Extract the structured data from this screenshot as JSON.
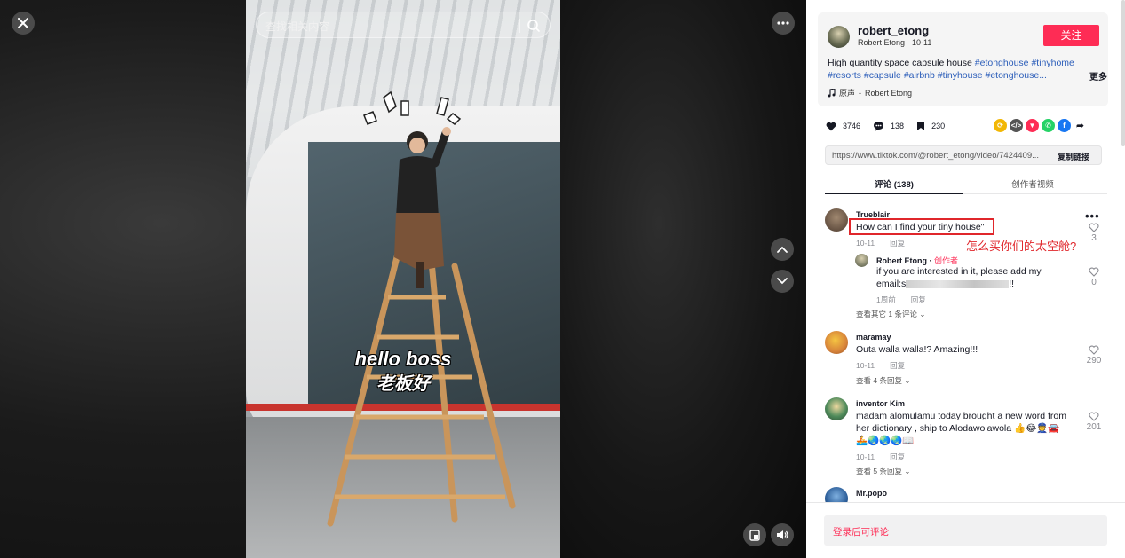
{
  "video": {
    "search_placeholder": "查找相关内容",
    "overlay_line1": "hello boss",
    "overlay_line2": "老板好"
  },
  "author": {
    "username": "robert_etong",
    "display_name": "Robert Etong",
    "date": "10-11",
    "follow_label": "关注"
  },
  "post": {
    "description_text": "High quantity space capsule house ",
    "hashtags": [
      "#etonghouse",
      "#tinyhome",
      "#resorts",
      "#capsule",
      "#airbnb",
      "#tinyhouse",
      "#etonghouse..."
    ],
    "more_label": "更多",
    "music_label": "原声",
    "music_author": "Robert Etong"
  },
  "stats": {
    "likes": "3746",
    "comments": "138",
    "saves": "230"
  },
  "share": {
    "url": "https://www.tiktok.com/@robert_etong/video/7424409...",
    "copy_label": "复制链接"
  },
  "tabs": {
    "comments_tab": "评论 (138)",
    "creator_videos_tab": "创作者视频"
  },
  "comments": [
    {
      "user": "Trueblair",
      "text": "How can I find your tiny house\"",
      "date": "10-11",
      "reply_label": "回复",
      "likes": "3",
      "annotation": "怎么买你们的太空舱?",
      "replies": [
        {
          "user": "Robert Etong",
          "creator_label": "创作者",
          "text_line1": "if you are interested in it, please add my",
          "text_line2": "email:s",
          "text_end": "!!",
          "date": "1周前",
          "reply_label": "回复",
          "likes": "0"
        }
      ],
      "view_more": "查看其它 1 条评论"
    },
    {
      "user": "maramay",
      "text": "Outa walla walla!? Amazing!!!",
      "date": "10-11",
      "reply_label": "回复",
      "likes": "290",
      "view_more": "查看 4 条回复"
    },
    {
      "user": "inventor Kim",
      "text_line1": "madam alomulamu today brought a new word from",
      "text_line2": "her dictionary , ship to Alodawolawola 👍😂👮🚘",
      "text_line3": "🚣🌏🌏🌏📖",
      "date": "10-11",
      "reply_label": "回复",
      "likes": "201",
      "view_more": "查看 5 条回复"
    },
    {
      "user": "Mr.popo"
    }
  ],
  "login_prompt": "登录后可评论",
  "colors": {
    "accent": "#fe2c55",
    "hashtag": "#2b5db9",
    "annotation": "#e0262b"
  }
}
